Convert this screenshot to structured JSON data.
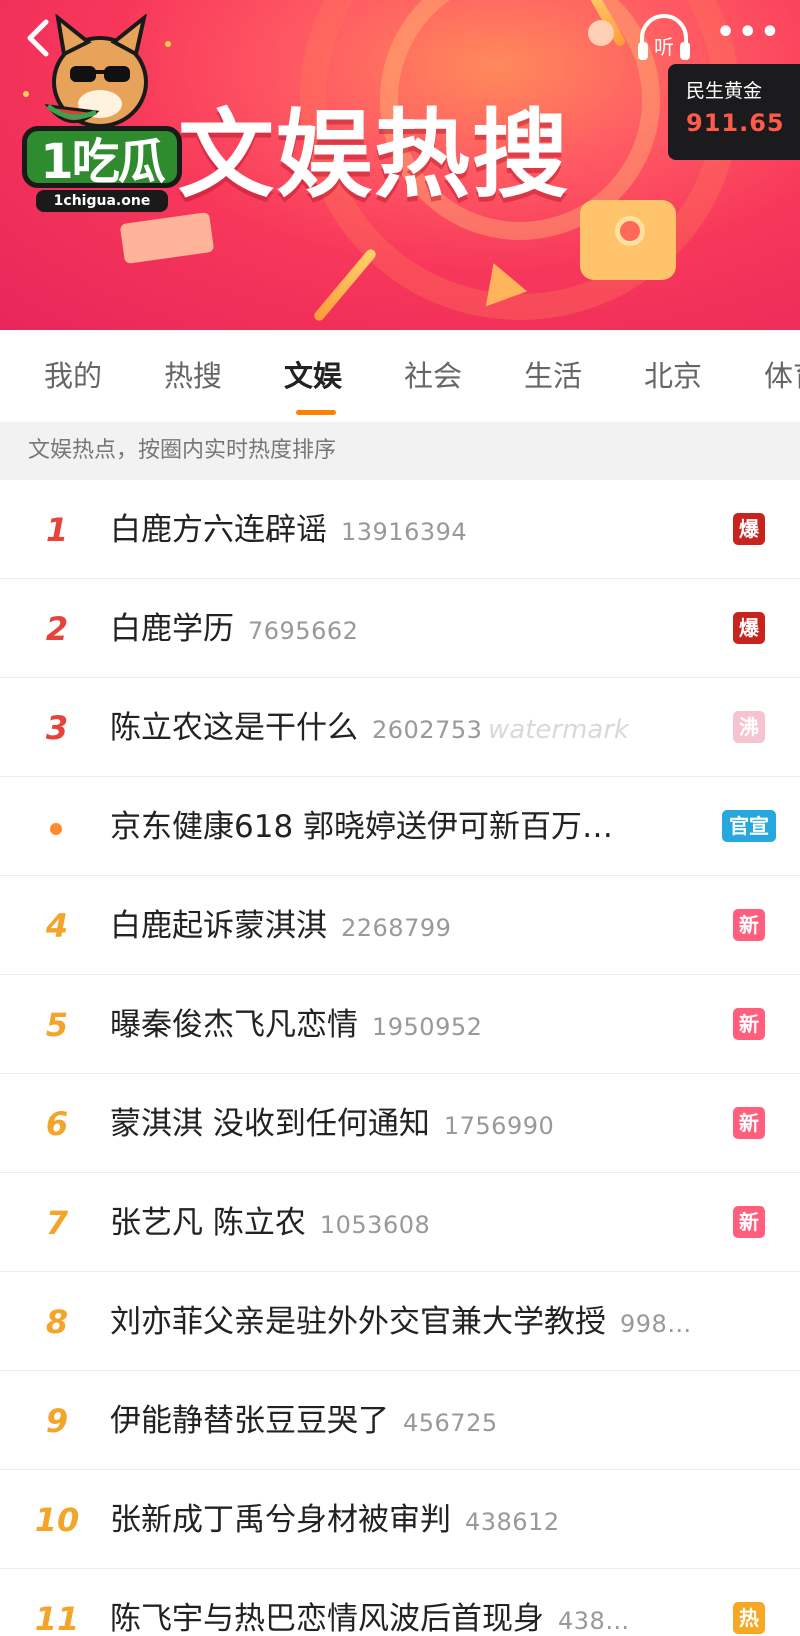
{
  "header": {
    "logo_text": "1吃瓜",
    "logo_url": "1chigua.one",
    "headline": "文娱热搜",
    "listen_label": "听",
    "more_label": "•••",
    "gold": {
      "name": "民生黄金",
      "price": "911.65"
    },
    "colors": {
      "banner_start": "#ff8a5b",
      "banner_end": "#e8265b",
      "accent": "#ff8200"
    }
  },
  "tabs": [
    {
      "label": "我的"
    },
    {
      "label": "热搜"
    },
    {
      "label": "文娱",
      "active": true
    },
    {
      "label": "社会"
    },
    {
      "label": "生活"
    },
    {
      "label": "北京"
    },
    {
      "label": "体育"
    }
  ],
  "subtitle": "文娱热点，按圈内实时热度排序",
  "items": [
    {
      "rank": "1",
      "title": "白鹿方六连辟谣",
      "heat": "13916394",
      "tag": "爆"
    },
    {
      "rank": "2",
      "title": "白鹿学历",
      "heat": "7695662",
      "tag": "爆"
    },
    {
      "rank": "3",
      "title": "陈立农这是干什么",
      "heat": "2602753",
      "tag": "沸",
      "overlay": "watermark"
    },
    {
      "rank": "",
      "title": "京东健康618 郭晓婷送伊可新百万…",
      "heat": "",
      "tag": "官宣"
    },
    {
      "rank": "4",
      "title": "白鹿起诉蒙淇淇",
      "heat": "2268799",
      "tag": "新"
    },
    {
      "rank": "5",
      "title": "曝秦俊杰飞凡恋情",
      "heat": "1950952",
      "tag": "新"
    },
    {
      "rank": "6",
      "title": "蒙淇淇 没收到任何通知",
      "heat": "1756990",
      "tag": "新"
    },
    {
      "rank": "7",
      "title": "张艺凡 陈立农",
      "heat": "1053608",
      "tag": "新"
    },
    {
      "rank": "8",
      "title": "刘亦菲父亲是驻外外交官兼大学教授",
      "heat": "998…",
      "tag": ""
    },
    {
      "rank": "9",
      "title": "伊能静替张豆豆哭了",
      "heat": "456725",
      "tag": ""
    },
    {
      "rank": "10",
      "title": "张新成丁禹兮身材被审判",
      "heat": "438612",
      "tag": ""
    },
    {
      "rank": "11",
      "title": "陈飞宇与热巴恋情风波后首现身",
      "heat": "438…",
      "tag": "热"
    }
  ]
}
